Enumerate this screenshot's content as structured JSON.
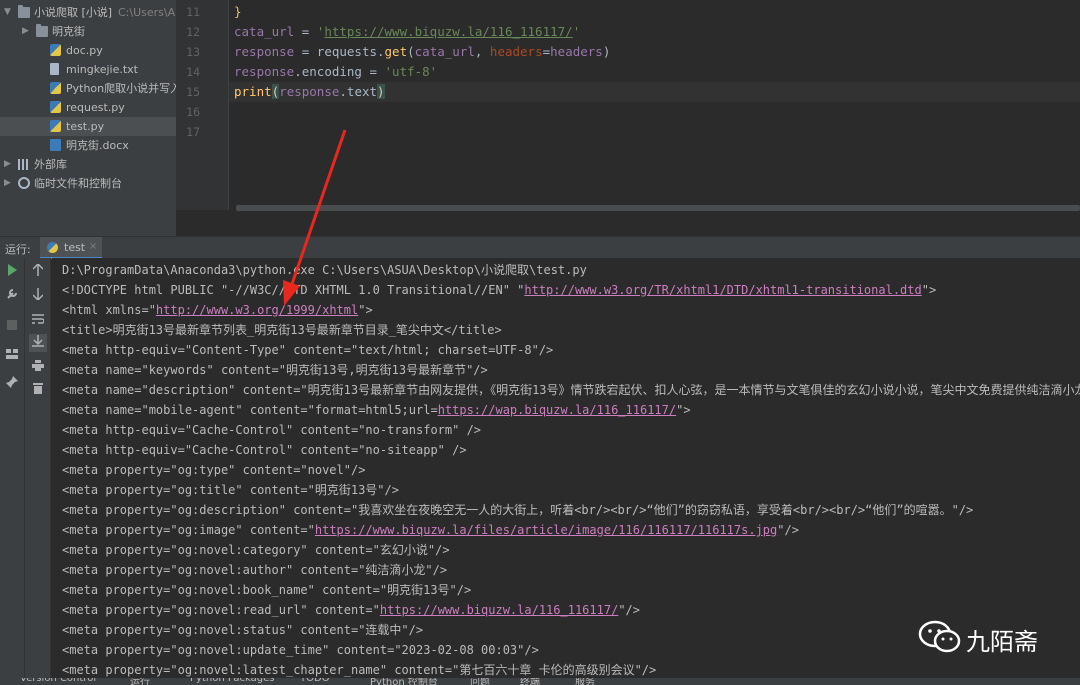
{
  "project_tree": {
    "items": [
      {
        "label": "小说爬取 [小说]",
        "hint": "C:\\Users\\A",
        "type": "folder",
        "expanded": true,
        "selected": false
      },
      {
        "label": "明克街",
        "hint": "",
        "type": "folder",
        "expanded": false,
        "selected": false
      },
      {
        "label": "doc.py",
        "hint": "",
        "type": "py",
        "selected": false
      },
      {
        "label": "mingkejie.txt",
        "hint": "",
        "type": "txt",
        "selected": false
      },
      {
        "label": "Python爬取小说并写入w",
        "hint": "",
        "type": "py",
        "selected": false
      },
      {
        "label": "request.py",
        "hint": "",
        "type": "py",
        "selected": false
      },
      {
        "label": "test.py",
        "hint": "",
        "type": "py",
        "selected": true
      },
      {
        "label": "明克街.docx",
        "hint": "",
        "type": "docx",
        "selected": false
      },
      {
        "label": "外部库",
        "hint": "",
        "type": "lib",
        "expanded": false,
        "selected": false
      },
      {
        "label": "临时文件和控制台",
        "hint": "",
        "type": "scratch",
        "expanded": false,
        "selected": false
      }
    ]
  },
  "editor": {
    "line_numbers": [
      "11",
      "12",
      "13",
      "14",
      "15",
      "16",
      "17"
    ],
    "lines": [
      {
        "segments": [
          {
            "t": "}",
            "c": "brace"
          }
        ]
      },
      {
        "segments": [
          {
            "t": "cata_url",
            "c": "var"
          },
          {
            "t": " = ",
            "c": ""
          },
          {
            "t": "'",
            "c": "str"
          },
          {
            "t": "https://www.biquzw.la/116_116117/",
            "c": "url"
          },
          {
            "t": "'",
            "c": "str"
          }
        ]
      },
      {
        "segments": [
          {
            "t": "response",
            "c": "var"
          },
          {
            "t": " = requests.",
            "c": ""
          },
          {
            "t": "get",
            "c": "fn"
          },
          {
            "t": "(",
            "c": ""
          },
          {
            "t": "cata_url",
            "c": "var"
          },
          {
            "t": ", ",
            "c": ""
          },
          {
            "t": "headers",
            "c": "kw"
          },
          {
            "t": "=",
            "c": ""
          },
          {
            "t": "headers",
            "c": "var"
          },
          {
            "t": ")",
            "c": ""
          }
        ]
      },
      {
        "segments": [
          {
            "t": "response",
            "c": "var"
          },
          {
            "t": ".encoding = ",
            "c": ""
          },
          {
            "t": "'utf-8'",
            "c": "str"
          }
        ]
      },
      {
        "segments": [
          {
            "t": "print",
            "c": "fn"
          },
          {
            "t": "(",
            "c": "paren"
          },
          {
            "t": "response",
            "c": "var"
          },
          {
            "t": ".text",
            "c": ""
          },
          {
            "t": ")",
            "c": "paren"
          }
        ]
      },
      {
        "segments": []
      },
      {
        "segments": []
      }
    ]
  },
  "run_panel": {
    "label": "运行:",
    "tab_label": "test",
    "tab_close": "×"
  },
  "console": {
    "lines": [
      [
        {
          "t": "D:\\ProgramData\\Anaconda3\\python.exe C:\\Users\\ASUA\\Desktop\\小说爬取\\test.py",
          "link": false
        }
      ],
      [
        {
          "t": "<!DOCTYPE html PUBLIC \"-//W3C//DTD XHTML 1.0 Transitional//EN\" \"",
          "link": false
        },
        {
          "t": "http://www.w3.org/TR/xhtml1/DTD/xhtml1-transitional.dtd",
          "link": true
        },
        {
          "t": "\">",
          "link": false
        }
      ],
      [
        {
          "t": "<html xmlns=\"",
          "link": false
        },
        {
          "t": "http://www.w3.org/1999/xhtml",
          "link": true
        },
        {
          "t": "\">",
          "link": false
        }
      ],
      [
        {
          "t": "<title>明克街13号最新章节列表_明克街13号最新章节目录_笔尖中文</title>",
          "link": false
        }
      ],
      [
        {
          "t": "<meta http-equiv=\"Content-Type\" content=\"text/html; charset=UTF-8\"/>",
          "link": false
        }
      ],
      [
        {
          "t": "<meta name=\"keywords\" content=\"明克街13号,明克街13号最新章节\"/>",
          "link": false
        }
      ],
      [
        {
          "t": "<meta name=\"description\" content=\"明克街13号最新章节由网友提供，《明克街13号》情节跌宕起伏、扣人心弦，是一本情节与文笔俱佳的玄幻小说小说，笔尖中文免费提供纯洁滴小龙",
          "link": false
        }
      ],
      [
        {
          "t": "<meta name=\"mobile-agent\" content=\"format=html5;url=",
          "link": false
        },
        {
          "t": "https://wap.biquzw.la/116_116117/",
          "link": true
        },
        {
          "t": "\">",
          "link": false
        }
      ],
      [
        {
          "t": "<meta http-equiv=\"Cache-Control\" content=\"no-transform\" />",
          "link": false
        }
      ],
      [
        {
          "t": "<meta http-equiv=\"Cache-Control\" content=\"no-siteapp\" />",
          "link": false
        }
      ],
      [
        {
          "t": "<meta property=\"og:type\" content=\"novel\"/>",
          "link": false
        }
      ],
      [
        {
          "t": "<meta property=\"og:title\" content=\"明克街13号\"/>",
          "link": false
        }
      ],
      [
        {
          "t": "<meta property=\"og:description\" content=\"我喜欢坐在夜晚空无一人的大街上，听着<br/><br/>“他们”的窃窃私语，享受着<br/><br/>“他们”的喧嚣。\"/>",
          "link": false
        }
      ],
      [
        {
          "t": "<meta property=\"og:image\" content=\"",
          "link": false
        },
        {
          "t": "https://www.biquzw.la/files/article/image/116/116117/116117s.jpg",
          "link": true
        },
        {
          "t": "\"/>",
          "link": false
        }
      ],
      [
        {
          "t": "<meta property=\"og:novel:category\" content=\"玄幻小说\"/>",
          "link": false
        }
      ],
      [
        {
          "t": "<meta property=\"og:novel:author\" content=\"纯洁滴小龙\"/>",
          "link": false
        }
      ],
      [
        {
          "t": "<meta property=\"og:novel:book_name\" content=\"明克街13号\"/>",
          "link": false
        }
      ],
      [
        {
          "t": "<meta property=\"og:novel:read_url\" content=\"",
          "link": false
        },
        {
          "t": "https://www.biquzw.la/116_116117/",
          "link": true
        },
        {
          "t": "\"/>",
          "link": false
        }
      ],
      [
        {
          "t": "<meta property=\"og:novel:status\" content=\"连载中\"/>",
          "link": false
        }
      ],
      [
        {
          "t": "<meta property=\"og:novel:update_time\" content=\"2023-02-08 00:03\"/>",
          "link": false
        }
      ],
      [
        {
          "t": "<meta property=\"og:novel:latest_chapter_name\" content=\"第七百六十章 卡伦的高级别会议\"/>",
          "link": false
        }
      ]
    ]
  },
  "watermark": {
    "text": "九陌斋",
    "icon": "wechat-icon"
  },
  "bottom_strip": {
    "items": [
      "Version Control",
      "运行",
      "Python Packages",
      "TODO",
      "Python 控制台",
      "问题",
      "终端",
      "服务"
    ]
  },
  "colors": {
    "annotation_arrow": "#e8281e",
    "link": "#cc7ec0",
    "run_green": "#59a869"
  }
}
